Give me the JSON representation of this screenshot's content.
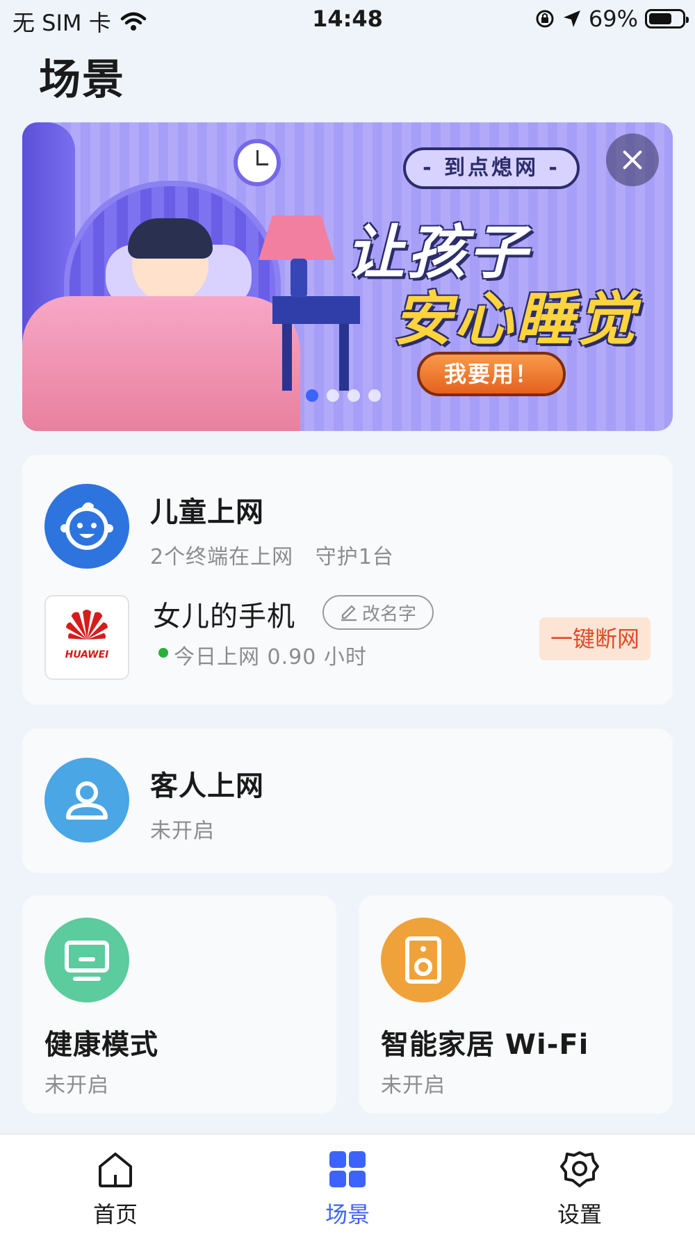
{
  "status_bar": {
    "carrier": "无 SIM 卡",
    "time": "14:48",
    "battery": "69%",
    "battery_level": 0.69
  },
  "page": {
    "title": "场景"
  },
  "banner": {
    "tag": "- 到点熄网 -",
    "headline_line1": "让孩子",
    "headline_line2": "安心睡觉",
    "cta": "我要用！",
    "dots_total": 4,
    "active_dot": 0
  },
  "kids_card": {
    "title": "儿童上网",
    "subtitle": "2个终端在上网   守护1台",
    "icon": "baby-face-icon",
    "icon_color": "#2e74de",
    "device": {
      "brand": "HUAWEI",
      "name": "女儿的手机",
      "rename_label": "改名字",
      "usage": "今日上网 0.90 小时",
      "disconnect_label": "一键断网"
    }
  },
  "guest_card": {
    "title": "客人上网",
    "status": "未开启",
    "icon": "person-icon",
    "icon_color": "#4aa6e4"
  },
  "health_card": {
    "title": "健康模式",
    "status": "未开启",
    "icon": "monitor-icon",
    "icon_color": "#5ccb9d"
  },
  "smarthome_card": {
    "title": "智能家居 Wi-Fi",
    "status": "未开启",
    "icon": "speaker-icon",
    "icon_color": "#f0a23a"
  },
  "bottom_nav": [
    {
      "label": "首页",
      "icon": "home-icon"
    },
    {
      "label": "场景",
      "icon": "grid-icon"
    },
    {
      "label": "设置",
      "icon": "gear-icon"
    }
  ],
  "colors": {
    "accent": "#3d63ff",
    "disconnect_text": "#e04a26",
    "disconnect_bg": "#fde5d6"
  }
}
